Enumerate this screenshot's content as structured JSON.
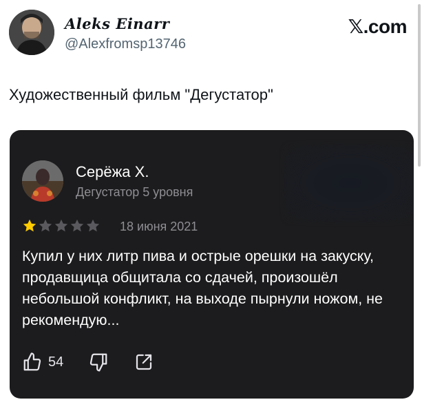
{
  "post": {
    "display_name": "Aleks Einarr",
    "handle": "@Alexfromsp13746",
    "brand": "𝕏.com",
    "text": "Художественный фильм \"Дегустатор\""
  },
  "review": {
    "reviewer_name": "Серёжа Х.",
    "reviewer_level": "Дегустатор 5 уровня",
    "rating": 1,
    "rating_max": 5,
    "date": "18 июня 2021",
    "text": "Купил у них литр пива и острые орешки на закуску, продавщица общитала со сдачей, произошёл небольшой конфликт, на выходе пырнули ножом, не рекомендую...",
    "likes": "54"
  },
  "colors": {
    "card_bg": "#1c1c1e",
    "star_filled": "#ffcc00",
    "star_empty": "#5a5a5e",
    "muted_text": "#8e8e93"
  },
  "icons": [
    "thumbs-up-icon",
    "thumbs-down-icon",
    "share-icon"
  ]
}
